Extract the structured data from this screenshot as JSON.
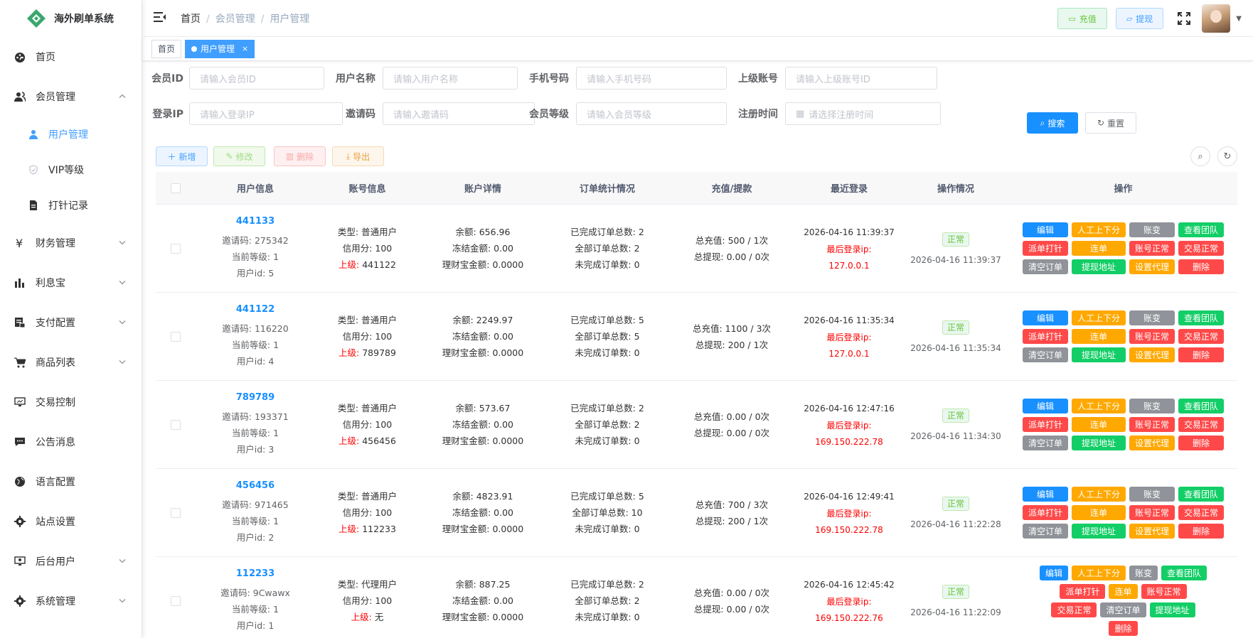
{
  "app": {
    "title": "海外刷单系统"
  },
  "sidebar": {
    "items": [
      {
        "label": "首页",
        "icon": "dashboard-icon"
      },
      {
        "label": "会员管理",
        "icon": "users-icon",
        "expanded": true,
        "children": [
          {
            "label": "用户管理",
            "icon": "user-icon",
            "active": true
          },
          {
            "label": "VIP等级",
            "icon": "shield-icon"
          },
          {
            "label": "打针记录",
            "icon": "document-icon"
          }
        ]
      },
      {
        "label": "财务管理",
        "icon": "yen-icon"
      },
      {
        "label": "利息宝",
        "icon": "bar-chart-icon"
      },
      {
        "label": "支付配置",
        "icon": "payment-icon"
      },
      {
        "label": "商品列表",
        "icon": "cart-icon"
      },
      {
        "label": "交易控制",
        "icon": "monitor-icon"
      },
      {
        "label": "公告消息",
        "icon": "message-icon"
      },
      {
        "label": "语言配置",
        "icon": "globe-icon"
      },
      {
        "label": "站点设置",
        "icon": "gear-icon"
      },
      {
        "label": "后台用户",
        "icon": "monitor-user-icon"
      },
      {
        "label": "系统管理",
        "icon": "settings-icon"
      }
    ]
  },
  "header": {
    "breadcrumb": [
      "首页",
      "会员管理",
      "用户管理"
    ],
    "recharge": "充值",
    "withdraw": "提现"
  },
  "tags": [
    {
      "label": "首页",
      "active": false
    },
    {
      "label": "用户管理",
      "active": true,
      "close": "×"
    }
  ],
  "search": {
    "member_id": {
      "label": "会员ID",
      "placeholder": "请输入会员ID"
    },
    "username": {
      "label": "用户名称",
      "placeholder": "请输入用户名称"
    },
    "phone": {
      "label": "手机号码",
      "placeholder": "请输入手机号码"
    },
    "parent": {
      "label": "上级账号",
      "placeholder": "请输入上级账号ID"
    },
    "login_ip": {
      "label": "登录IP",
      "placeholder": "请输入登录IP"
    },
    "invite": {
      "label": "邀请码",
      "placeholder": "请输入邀请码"
    },
    "level": {
      "label": "会员等级",
      "placeholder": "请输入会员等级"
    },
    "reg_time": {
      "label": "注册时间",
      "placeholder": "请选择注册时间"
    },
    "search_btn": "搜索",
    "reset_btn": "重置"
  },
  "toolbar": {
    "add": "新增",
    "edit": "修改",
    "delete": "删除",
    "export": "导出"
  },
  "table": {
    "headers": [
      "用户信息",
      "账号信息",
      "账户详情",
      "订单统计情况",
      "充值/提款",
      "最近登录",
      "操作情况",
      "操作"
    ],
    "labels": {
      "invite": "邀请码: ",
      "level": "当前等级: ",
      "uid": "用户id: ",
      "type": "类型: ",
      "credit": "信用分: ",
      "parent": "上级: ",
      "balance": "余额: ",
      "frozen": "冻结金额: ",
      "wealth": "理财宝金额: ",
      "done": "已完成订单总数: ",
      "all": "全部订单总数: ",
      "undone": "未完成订单数: ",
      "recharge": "总充值: ",
      "withdraw": "总提现: ",
      "last_ip": "最后登录ip:"
    },
    "ops": {
      "edit": "编辑",
      "manual": "人工上下分",
      "ledger": "账变",
      "team": "查看团队",
      "inject": "派单打针",
      "chain": "连单",
      "acct": "账号正常",
      "trade": "交易正常",
      "clear": "清空订单",
      "addr": "提现地址",
      "agent": "设置代理",
      "del": "删除"
    },
    "rows": [
      {
        "id": "441133",
        "invite": "275342",
        "level": "1",
        "uid": "5",
        "type": "普通用户",
        "credit": "100",
        "parent": "441122",
        "balance": "656.96",
        "frozen": "0.00",
        "wealth": "0.0000",
        "done": "2",
        "all": "2",
        "undone": "0",
        "recharge": "500 / 1次",
        "withdraw": "0.00 / 0次",
        "login_time": "2026-04-16 11:39:37",
        "ip": "127.0.0.1",
        "status": "正常",
        "status_time": "2026-04-16 11:39:37",
        "agent_btn": true
      },
      {
        "id": "441122",
        "invite": "116220",
        "level": "1",
        "uid": "4",
        "type": "普通用户",
        "credit": "100",
        "parent": "789789",
        "balance": "2249.97",
        "frozen": "0.00",
        "wealth": "0.0000",
        "done": "5",
        "all": "5",
        "undone": "0",
        "recharge": "1100 / 3次",
        "withdraw": "200 / 1次",
        "login_time": "2026-04-16 11:35:34",
        "ip": "127.0.0.1",
        "status": "正常",
        "status_time": "2026-04-16 11:35:34",
        "agent_btn": true
      },
      {
        "id": "789789",
        "invite": "193371",
        "level": "1",
        "uid": "3",
        "type": "普通用户",
        "credit": "100",
        "parent": "456456",
        "balance": "573.67",
        "frozen": "0.00",
        "wealth": "0.0000",
        "done": "2",
        "all": "2",
        "undone": "0",
        "recharge": "0.00 / 0次",
        "withdraw": "0.00 / 0次",
        "login_time": "2026-04-16 12:47:16",
        "ip": "169.150.222.78",
        "status": "正常",
        "status_time": "2026-04-16 11:34:30",
        "agent_btn": true
      },
      {
        "id": "456456",
        "invite": "971465",
        "level": "1",
        "uid": "2",
        "type": "普通用户",
        "credit": "100",
        "parent": "112233",
        "balance": "4823.91",
        "frozen": "0.00",
        "wealth": "0.0000",
        "done": "5",
        "all": "10",
        "undone": "0",
        "recharge": "700 / 3次",
        "withdraw": "200 / 1次",
        "login_time": "2026-04-16 12:49:41",
        "ip": "169.150.222.78",
        "status": "正常",
        "status_time": "2026-04-16 11:22:28",
        "agent_btn": true
      },
      {
        "id": "112233",
        "invite": "9Cwawx",
        "level": "1",
        "uid": "1",
        "type": "代理用户",
        "credit": "100",
        "parent": "无",
        "balance": "887.25",
        "frozen": "0.00",
        "wealth": "0.0000",
        "done": "2",
        "all": "2",
        "undone": "0",
        "recharge": "0.00 / 0次",
        "withdraw": "0.00 / 0次",
        "login_time": "2026-04-16 12:45:42",
        "ip": "169.150.222.76",
        "status": "正常",
        "status_time": "2026-04-16 11:22:09",
        "agent_btn": false
      }
    ]
  }
}
